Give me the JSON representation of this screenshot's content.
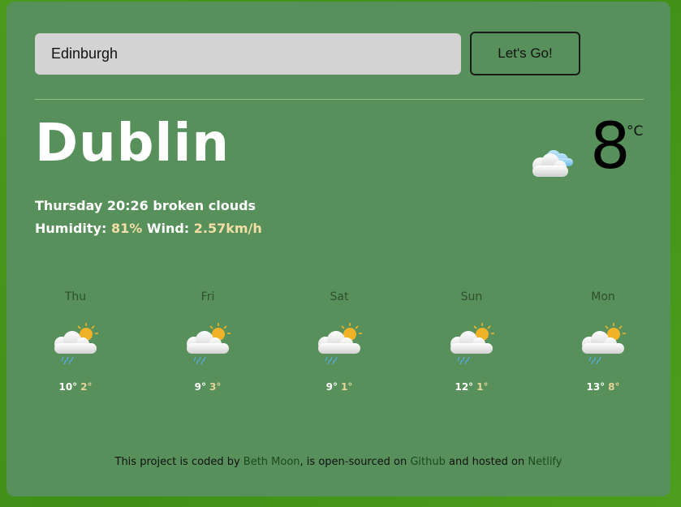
{
  "search": {
    "value": "Edinburgh",
    "button_label": "Let's Go!"
  },
  "current": {
    "city": "Dublin",
    "day_time": "Thursday 20:26",
    "description": "broken clouds",
    "humidity_label": "Humidity:",
    "humidity_value": "81%",
    "wind_label": "Wind:",
    "wind_value": "2.57km/h",
    "temperature": "8",
    "unit": "°C",
    "icon": "broken-clouds-icon"
  },
  "forecast": [
    {
      "day": "Thu",
      "max": "10°",
      "min": "2°",
      "icon": "sun-cloud-rain-icon"
    },
    {
      "day": "Fri",
      "max": "9°",
      "min": "3°",
      "icon": "sun-cloud-rain-icon"
    },
    {
      "day": "Sat",
      "max": "9°",
      "min": "1°",
      "icon": "sun-cloud-rain-icon"
    },
    {
      "day": "Sun",
      "max": "12°",
      "min": "1°",
      "icon": "sun-cloud-rain-icon"
    },
    {
      "day": "Mon",
      "max": "13°",
      "min": "8°",
      "icon": "sun-cloud-rain-icon"
    }
  ],
  "footer": {
    "t1": "This project is coded by",
    "author": "Beth Moon",
    "t2": ", is open-sourced on",
    "github": "Github",
    "t3": "and hosted on",
    "netlify": "Netlify"
  },
  "colors": {
    "card": "#57905a",
    "highlight": "#f3dfa6",
    "sun": "#f2b227",
    "rain": "#5aa8d8"
  }
}
